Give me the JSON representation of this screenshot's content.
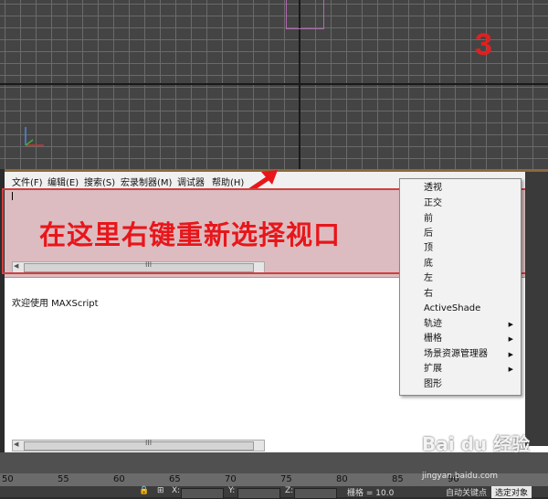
{
  "viewport": {
    "number_label": "3"
  },
  "listener": {
    "menu": [
      "文件(F)",
      "编辑(E)",
      "搜索(S)",
      "宏录制器(M)",
      "调试器",
      "帮助(H)"
    ],
    "annotation": "在这里右键重新选择视口",
    "welcome": "欢迎使用 MAXScript",
    "scroll_grip": "III"
  },
  "context_menu": {
    "items": [
      "透视",
      "正交",
      "前",
      "后",
      "顶",
      "底",
      "左",
      "右",
      "ActiveShade",
      "轨迹",
      "栅格",
      "场景资源管理器",
      "扩展",
      "图形"
    ],
    "submenu_arrow": "▶"
  },
  "timeline": {
    "ticks": [
      "50",
      "55",
      "60",
      "65",
      "70",
      "75",
      "80",
      "85",
      "90"
    ]
  },
  "status": {
    "x_label": "X:",
    "y_label": "Y:",
    "z_label": "Z:",
    "grid": "栅格 = 10.0",
    "auto_key": "自动关键点",
    "selected": "选定对象"
  },
  "watermark": {
    "brand": "Bai du 经验",
    "url": "jingyan.baidu.com"
  },
  "colors": {
    "annotation": "#e8161a",
    "macro_area": "#dcbcc0",
    "viewport": "#444444"
  }
}
